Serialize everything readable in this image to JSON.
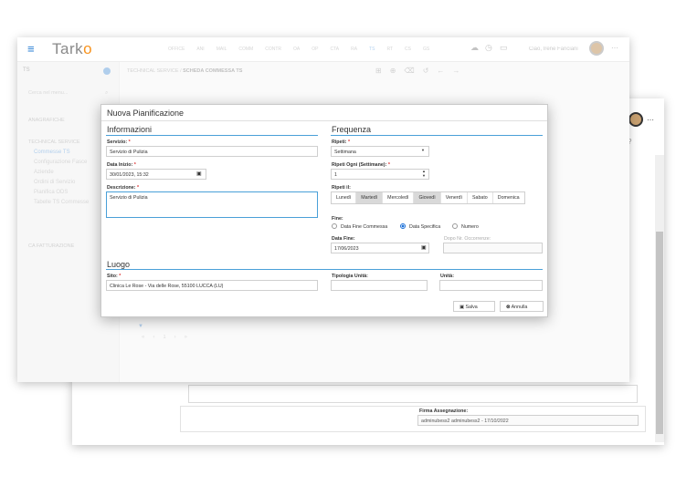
{
  "app": {
    "logo_text": "Tark",
    "logo_accent": "o",
    "brand_color": "#f7931e",
    "accent_color": "#4aa0d8"
  },
  "nav": {
    "tabs": [
      "OFFICE",
      "ANI",
      "MAIL",
      "COMM",
      "CONTR",
      "OA",
      "OP",
      "CTA",
      "RA",
      "TS",
      "RT",
      "CS",
      "GS"
    ],
    "user": "Ciao, Irene Fanciani"
  },
  "sidebar": {
    "search_placeholder": "Cerca nel menu...",
    "sections": [
      {
        "title": "ANAGRAFICHE",
        "items": []
      },
      {
        "title": "TECHNICAL SERVICE",
        "items": [
          "Commesse TS",
          "Configurazione Fasce",
          "Aziende",
          "Ordini di Servizio",
          "Pianifica ODS",
          "Tabelle TS Commesse"
        ]
      },
      {
        "title": "CA FATTURAZIONE",
        "items": []
      }
    ]
  },
  "breadcrumb": {
    "parent": "TECHNICAL SERVICE",
    "sep": "/",
    "current": "SCHEDA COMMESSA TS"
  },
  "back_page": {
    "firma_label": "Firma Assegnazione:",
    "firma_value": "adminubess2 adminubess2 - 17/10/2022"
  },
  "modal": {
    "title": "Nuova Pianificazione",
    "informazioni": {
      "title": "Informazioni",
      "servizio_label": "Servizio:",
      "servizio_value": "Servizio di Pulizia",
      "data_inizio_label": "Data Inizio:",
      "data_inizio_value": "30/01/2023, 15:32",
      "descrizione_label": "Descrizione:",
      "descrizione_value": "Servizio di Pulizia"
    },
    "frequenza": {
      "title": "Frequenza",
      "ripeti_label": "Ripeti:",
      "ripeti_value": "Settimana",
      "ripeti_ogni_label": "Ripeti Ogni (Settimane):",
      "ripeti_ogni_value": "1",
      "ripeti_il_label": "Ripeti il:",
      "days": [
        {
          "label": "Lunedì",
          "selected": false
        },
        {
          "label": "Martedì",
          "selected": true
        },
        {
          "label": "Mercoledì",
          "selected": false
        },
        {
          "label": "Giovedì",
          "selected": true
        },
        {
          "label": "Venerdì",
          "selected": false
        },
        {
          "label": "Sabato",
          "selected": false
        },
        {
          "label": "Domenica",
          "selected": false
        }
      ],
      "fine_label": "Fine:",
      "fine_options": [
        {
          "label": "Data Fine Commessa",
          "checked": false
        },
        {
          "label": "Data Specifica",
          "checked": true
        },
        {
          "label": "Numero",
          "checked": false
        }
      ],
      "data_fine_label": "Data Fine:",
      "data_fine_value": "17/06/2023",
      "dopo_label": "Dopo Nr. Occorrenze:",
      "dopo_value": ""
    },
    "luogo": {
      "title": "Luogo",
      "sito_label": "Sito:",
      "sito_value": "Clinica Le Rose - Via delle Rose, 55100 LUCCA (LU)",
      "tipologia_label": "Tipologia Unità:",
      "tipologia_value": "",
      "unita_label": "Unità:",
      "unita_value": ""
    },
    "buttons": {
      "save": "Salva",
      "cancel": "Annulla"
    }
  }
}
